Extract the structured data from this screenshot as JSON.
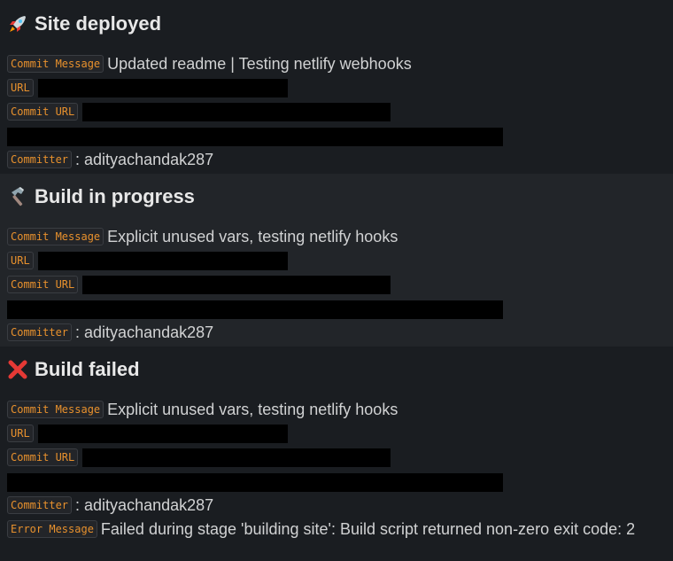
{
  "messages": [
    {
      "title": "Site deployed",
      "icon": "rocket-icon",
      "commit_message_label": "Commit Message",
      "commit_message": "Updated readme | Testing netlify webhooks",
      "url_label": "URL",
      "commit_url_label": "Commit URL",
      "committer_label": "Committer",
      "committer": ": adityachandak287"
    },
    {
      "title": "Build in progress",
      "icon": "hammer-icon",
      "commit_message_label": "Commit Message",
      "commit_message": "Explicit unused vars, testing netlify hooks",
      "url_label": "URL",
      "commit_url_label": "Commit URL",
      "committer_label": "Committer",
      "committer": ": adityachandak287"
    },
    {
      "title": "Build failed",
      "icon": "cross-mark-icon",
      "commit_message_label": "Commit Message",
      "commit_message": "Explicit unused vars, testing netlify hooks",
      "url_label": "URL",
      "commit_url_label": "Commit URL",
      "committer_label": "Committer",
      "committer": ": adityachandak287",
      "error_label": "Error Message",
      "error_message": "Failed during stage 'building site': Build script returned non-zero exit code: 2"
    }
  ],
  "colors": {
    "background": "#1a1d21",
    "hover_background": "#222529",
    "code_text": "#e8912d",
    "body_text": "#d1d2d3",
    "redaction": "#000000"
  }
}
